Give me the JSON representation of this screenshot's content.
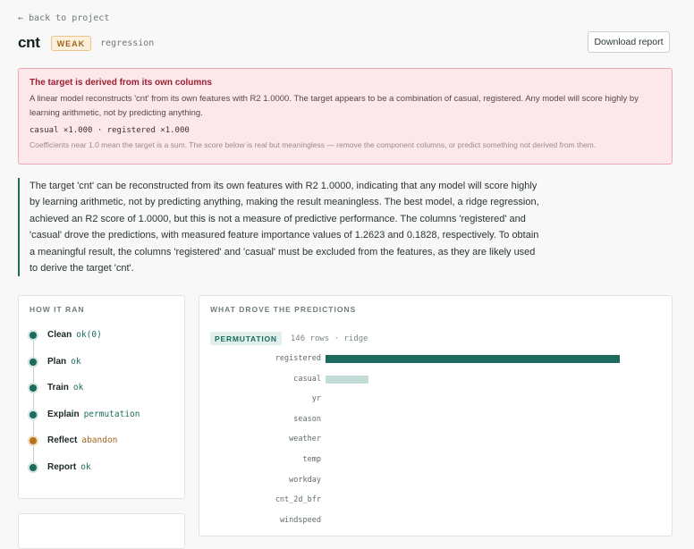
{
  "nav": {
    "back_label": "← back to project"
  },
  "header": {
    "title": "cnt",
    "badge": "WEAK",
    "task_type": "regression",
    "download_label": "Download report"
  },
  "alert": {
    "title": "The target is derived from its own columns",
    "body": "A linear model reconstructs 'cnt' from its own features with R2 1.0000. The target appears to be a combination of casual, registered. Any model will score highly by learning arithmetic, not by predicting anything.",
    "coefficients": "casual ×1.000 · registered ×1.000",
    "note": "Coefficients near 1.0 mean the target is a sum. The score below is real but meaningless — remove the component columns, or predict something not derived from them."
  },
  "summary": {
    "text": "The target 'cnt' can be reconstructed from its own features with R2 1.0000, indicating that any model will score highly by learning arithmetic, not by predicting anything, making the result meaningless. The best model, a ridge regression, achieved an R2 score of 1.0000, but this is not a measure of predictive performance. The columns 'registered' and 'casual' drove the predictions, with measured feature importance values of 1.2623 and 0.1828, respectively. To obtain a meaningful result, the columns 'registered' and 'casual' must be excluded from the features, as they are likely used to derive the target 'cnt'."
  },
  "how_it_ran": {
    "title": "HOW IT RAN",
    "steps": [
      {
        "name": "Clean",
        "status": "ok(0)",
        "state": "ok"
      },
      {
        "name": "Plan",
        "status": "ok",
        "state": "ok"
      },
      {
        "name": "Train",
        "status": "ok",
        "state": "ok"
      },
      {
        "name": "Explain",
        "status": "permutation",
        "state": "ok"
      },
      {
        "name": "Reflect",
        "status": "abandon",
        "state": "warn"
      },
      {
        "name": "Report",
        "status": "ok",
        "state": "ok"
      }
    ]
  },
  "predictions": {
    "title": "WHAT DROVE THE PREDICTIONS",
    "method_badge": "PERMUTATION",
    "meta": "146 rows · ridge"
  },
  "colors": {
    "accent": "#1d6b5e",
    "accent_light": "#c3dcd8",
    "warn": "#b8741a",
    "alert_bg": "#fce8ea",
    "alert_title": "#9c1f33"
  },
  "chart_data": {
    "type": "bar",
    "orientation": "horizontal",
    "categories": [
      "registered",
      "casual",
      "yr",
      "season",
      "weather",
      "temp",
      "workday",
      "cnt_2d_bfr",
      "windspeed"
    ],
    "values": [
      1.2623,
      0.1828,
      0,
      0,
      0,
      0,
      0,
      0,
      0
    ],
    "xlim": [
      0,
      1.275
    ]
  }
}
